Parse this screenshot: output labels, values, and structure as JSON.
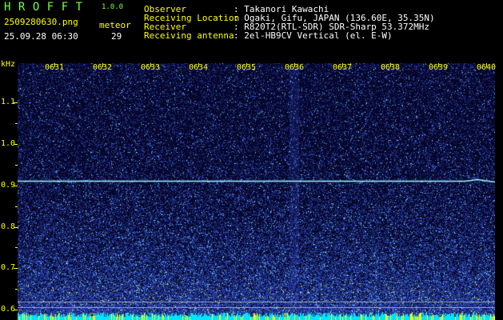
{
  "app": {
    "logo": "HROFFT",
    "version": "1.0.0"
  },
  "file": {
    "name": "2509280630.png",
    "datetime": "25.09.28 06:30"
  },
  "meteor": {
    "label": "meteor",
    "count": "29"
  },
  "info": [
    {
      "label": "Observer",
      "value": ": Takanori Kawachi"
    },
    {
      "label": "Receiving Location",
      "value": ": Ogaki, Gifu, JAPAN (136.60E, 35.35N)"
    },
    {
      "label": "Receiver",
      "value": ": R820T2(RTL-SDR) SDR-Sharp 53.372MHz"
    },
    {
      "label": "Receiving antenna",
      "value": ": 2el-HB9CV Vertical (el. E-W)"
    }
  ],
  "colors": {
    "green_text": "#7cff38",
    "yellow_text": "#ffff00",
    "white_text": "#ffffff",
    "background": "#000000",
    "spectrogram_base": "#06062a",
    "noise_blue": "#2a3cff",
    "signal_line": "#9ff6ff",
    "floor_cyan": "#00e5ff",
    "floor_yellow": "#ffff00"
  },
  "axes": {
    "y_unit": "kHz",
    "y_ticks": [
      "1.1",
      "1.0",
      "0.9",
      "0.8",
      "0.7",
      "0.6"
    ],
    "x_ticks": [
      "0631",
      "0632",
      "0633",
      "0634",
      "0635",
      "0636",
      "0637",
      "0638",
      "0639",
      "0640"
    ]
  },
  "spectrogram": {
    "y_range_khz": [
      0.575,
      1.195
    ],
    "carrier_khz": 0.91,
    "reference_lines_khz": [
      0.62,
      0.605
    ]
  }
}
